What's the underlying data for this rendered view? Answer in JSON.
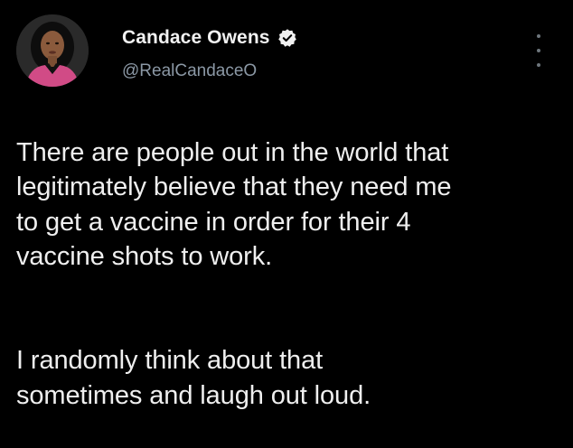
{
  "tweet": {
    "author": {
      "display_name": "Candace Owens",
      "handle": "@RealCandaceO",
      "verified": true,
      "avatar_icon": "profile-photo"
    },
    "more_icon": "more-dots-vertical-icon",
    "paragraphs": [
      "There are people out in the world that\nlegitimately believe that they need me\nto get a vaccine in order for their 4\nvaccine shots to work.",
      "I randomly think about that\nsometimes and laugh out loud."
    ]
  },
  "colors": {
    "background": "#000000",
    "text": "#efefef",
    "handle": "#8b98a5",
    "verified_badge": "#f1f1f1"
  }
}
